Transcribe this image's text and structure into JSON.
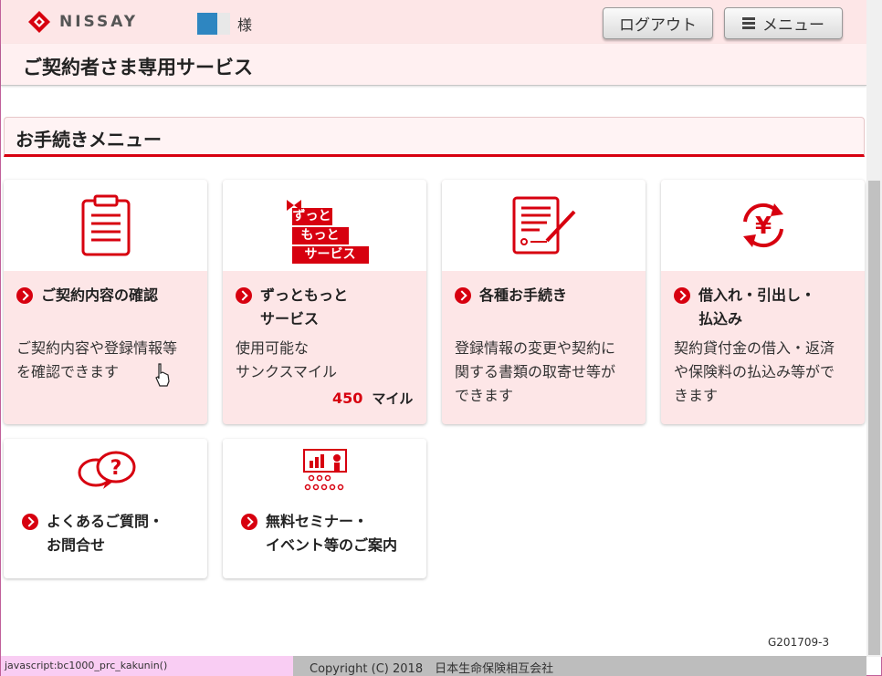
{
  "header": {
    "brand": "NISSAY",
    "user_suffix": "様",
    "logout_label": "ログアウト",
    "menu_label": "メニュー",
    "service_title": "ご契約者さま専用サービス"
  },
  "section": {
    "title": "お手続きメニュー"
  },
  "cards": [
    {
      "title": "ご契約内容の確認",
      "desc": [
        "ご契約内容や登録情報等",
        "を確認できます"
      ],
      "icon": "clipboard-icon"
    },
    {
      "title": [
        "ずっともっと",
        "サービス"
      ],
      "desc": [
        "使用可能な",
        "サンクスマイル"
      ],
      "icon": "zuttomotto-logo-icon",
      "miles": {
        "value": "450",
        "unit": "マイル"
      },
      "logo_text": [
        "ずっと",
        "もっと",
        "サービス"
      ]
    },
    {
      "title": "各種お手続き",
      "desc": [
        "登録情報の変更や契約に",
        "関する書類の取寄せ等が",
        "できます"
      ],
      "icon": "document-pen-icon"
    },
    {
      "title": [
        "借入れ・引出し・",
        "払込み"
      ],
      "desc": [
        "契約貸付金の借入・返済",
        "や保険料の払込み等がで",
        "きます"
      ],
      "icon": "yen-exchange-icon"
    },
    {
      "title": [
        "よくあるご質問・",
        "お問合せ"
      ],
      "icon": "question-bubbles-icon"
    },
    {
      "title": [
        "無料セミナー・",
        "イベント等のご案内"
      ],
      "icon": "seminar-icon"
    }
  ],
  "page_code": "G201709-3",
  "footer": {
    "status": "javascript:bc1000_prc_kakunin()",
    "copyright": "Copyright (C) 2018　日本生命保険相互会社"
  },
  "colors": {
    "accent": "#d7000f",
    "card_bg": "#fde6e7",
    "header_bg": "#fde6e7"
  }
}
